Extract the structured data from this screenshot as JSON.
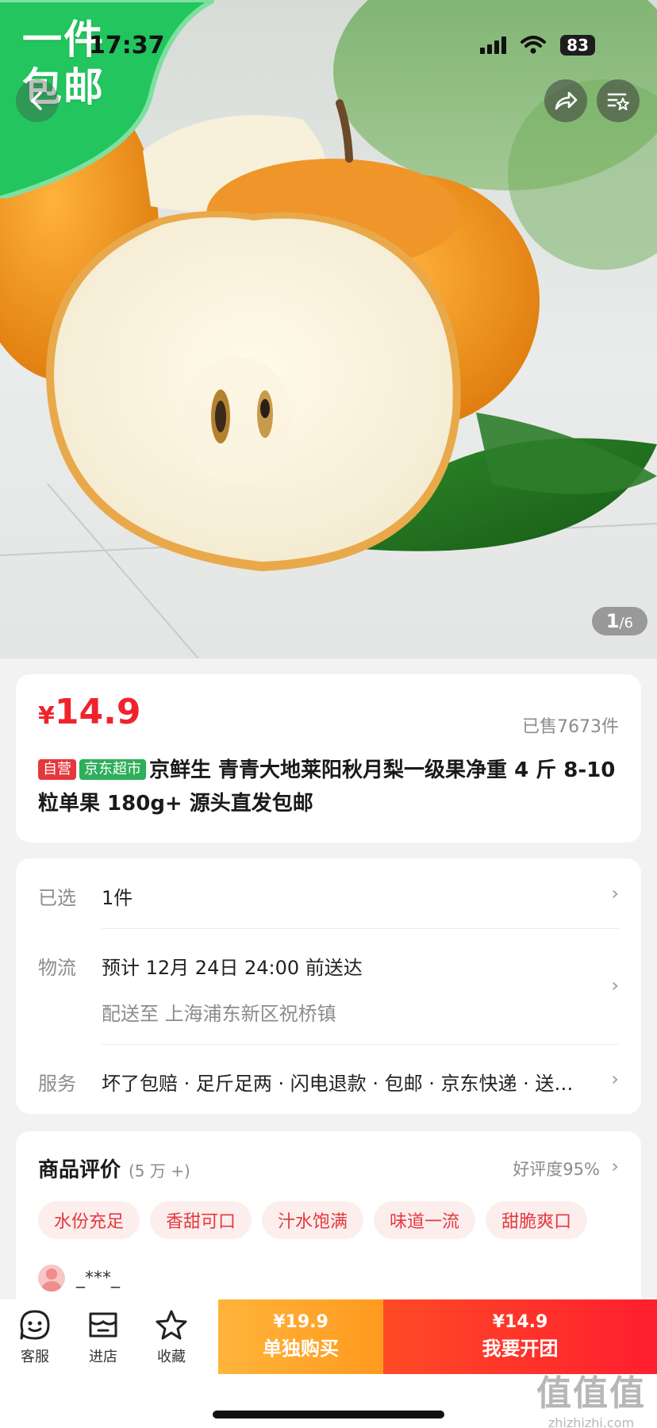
{
  "status_bar": {
    "time": "17:37",
    "battery": "83"
  },
  "hero": {
    "promo_line1": "一件",
    "promo_line2": "包邮",
    "page_current": "1",
    "page_total": "/6"
  },
  "product": {
    "currency": "¥",
    "price": "14.9",
    "sold": "已售7673件",
    "tag_self": "自营",
    "tag_market": "京东超市",
    "title": "京鲜生 青青大地莱阳秋月梨一级果净重 4 斤 8-10 粒单果 180g+ 源头直发包邮"
  },
  "info": {
    "selected_label": "已选",
    "selected_value": "1件",
    "logistics_label": "物流",
    "logistics_value": "预计 12月 24日 24:00 前送达",
    "logistics_address": "配送至 上海浦东新区祝桥镇",
    "service_label": "服务",
    "service_value": "坏了包赔 · 足斤足两 · 闪电退款 · 包邮 · 京东快递 · 送…"
  },
  "reviews": {
    "title": "商品评价",
    "count": "(5 万 +)",
    "rating": "好评度95%",
    "chips": [
      "水份充足",
      "香甜可口",
      "汁水饱满",
      "味道一流",
      "甜脆爽口"
    ],
    "reviewer": "_***_"
  },
  "bottom_bar": {
    "service": "客服",
    "shop": "进店",
    "favorite": "收藏",
    "solo_price": "¥19.9",
    "solo_label": "单独购买",
    "group_price": "¥14.9",
    "group_label": "我要开团"
  },
  "watermark": {
    "big": "值值值",
    "small": "zhizhizhi.com"
  },
  "colors": {
    "accent_red": "#f0232d",
    "promo_green": "#22c55e",
    "solo_orange": "#ffa62b",
    "group_red": "#ff2a2a"
  }
}
